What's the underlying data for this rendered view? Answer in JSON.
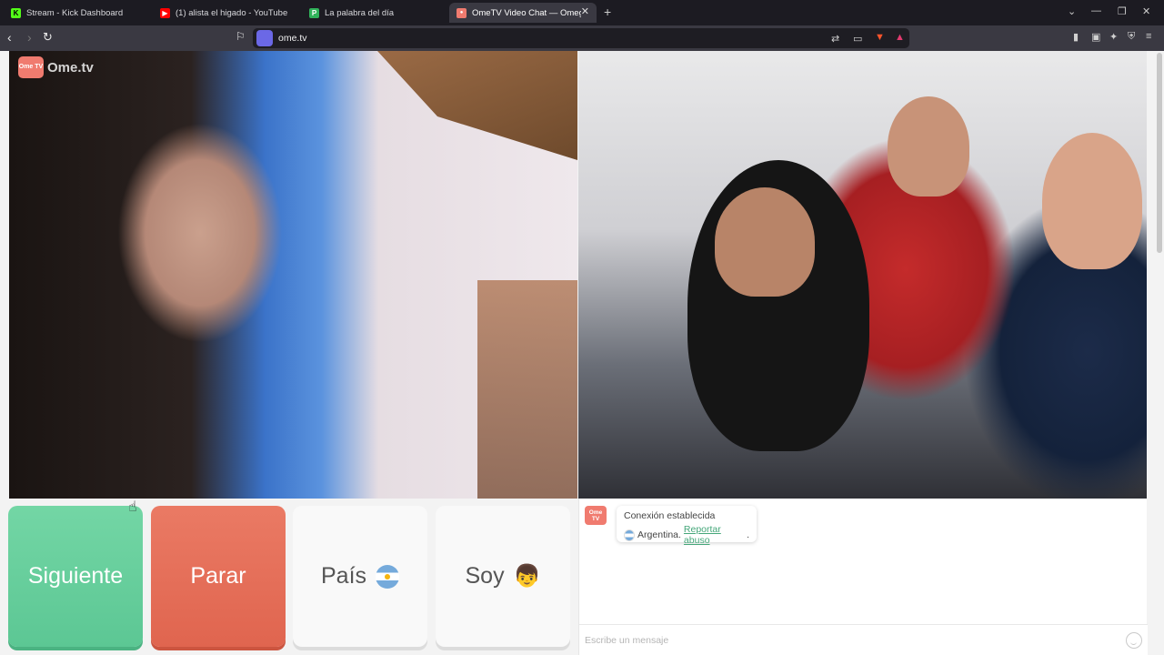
{
  "browser": {
    "tabs": [
      {
        "label": "Stream - Kick Dashboard",
        "favicon": "K",
        "color": "#53fc18"
      },
      {
        "label": "(1) alista el higado - YouTube",
        "favicon": "▶",
        "color": "#ff0000"
      },
      {
        "label": "La palabra del día",
        "favicon": "P",
        "color": "#30b25a"
      },
      {
        "label": "OmeTV Video Chat — Omeg",
        "favicon": "●",
        "color": "#f07b6f"
      }
    ],
    "new_tab": "+",
    "url": "ome.tv"
  },
  "logo": {
    "badge": "Ome TV",
    "text": "Ome.tv"
  },
  "controls": {
    "next_label": "Siguiente",
    "stop_label": "Parar",
    "country_label": "País",
    "gender_label": "Soy",
    "gender_emoji": "👦"
  },
  "chat": {
    "avatar": "Ome TV",
    "status_title": "Conexión establecida",
    "country": "Argentina.",
    "report_link": "Reportar abuso",
    "report_suffix": ".",
    "input_placeholder": "Escribe un mensaje"
  },
  "colors": {
    "next": "#5cc794",
    "stop": "#e0654f",
    "brand": "#f07b6f",
    "link": "#45a77a"
  }
}
